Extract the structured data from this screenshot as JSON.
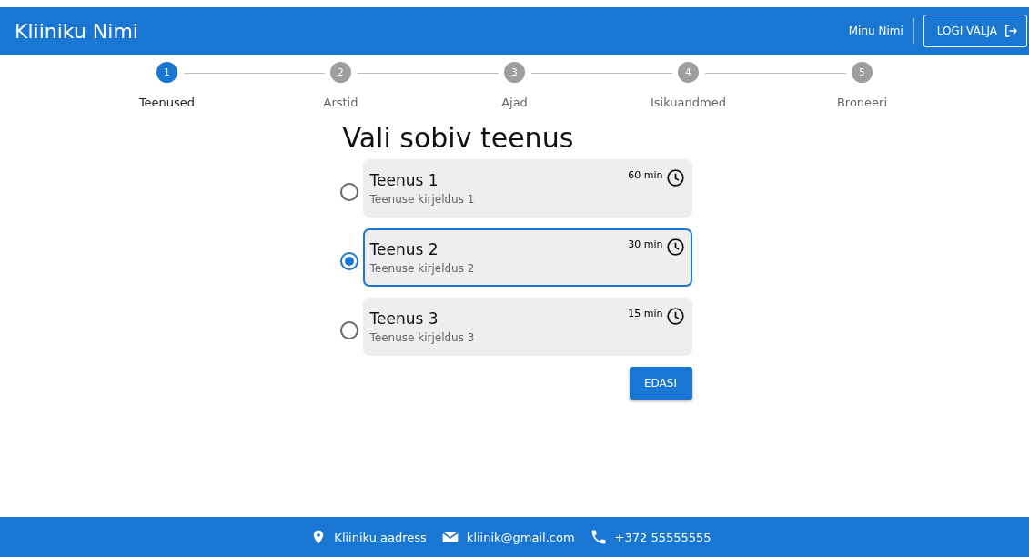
{
  "header": {
    "title": "Kliiniku Nimi",
    "user": "Minu Nimi",
    "logout": "LOGI VÄLJA"
  },
  "steps": [
    {
      "number": "1",
      "label": "Teenused",
      "selected": true
    },
    {
      "number": "2",
      "label": "Arstid",
      "selected": false
    },
    {
      "number": "3",
      "label": "Ajad",
      "selected": false
    },
    {
      "number": "4",
      "label": "Isikuandmed",
      "selected": false
    },
    {
      "number": "5",
      "label": "Broneeri",
      "selected": false
    }
  ],
  "heading": "Vali sobiv teenus",
  "services": [
    {
      "name": "Teenus 1",
      "description": "Teenuse kirjeldus 1",
      "duration": "60 min",
      "selected": false
    },
    {
      "name": "Teenus 2",
      "description": "Teenuse kirjeldus 2",
      "duration": "30 min",
      "selected": true
    },
    {
      "name": "Teenus 3",
      "description": "Teenuse kirjeldus 3",
      "duration": "15 min",
      "selected": false
    }
  ],
  "next_button": "EDASI",
  "footer": {
    "address": "Kliiniku aadress",
    "email": "kliinik@gmail.com",
    "phone": "+372 55555555"
  }
}
